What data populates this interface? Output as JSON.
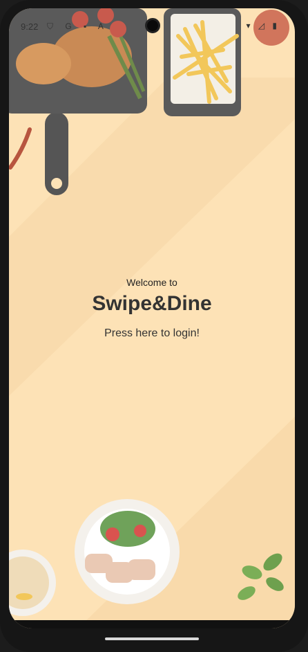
{
  "status_bar": {
    "time": "9:22",
    "left_icons": [
      "shield-icon",
      "google-icon",
      "sim-icon",
      "font-icon"
    ],
    "right_icons": [
      "wifi-icon",
      "signal-icon",
      "battery-icon"
    ],
    "left_glyphs": "⛉ G ▪ A",
    "right_glyphs": "▾ ◿ ▮"
  },
  "welcome": {
    "greeting": "Welcome to",
    "app_name": "Swipe&Dine",
    "login_prompt": "Press here to login!"
  },
  "colors": {
    "background": "#fde2b6",
    "text": "#333333"
  }
}
